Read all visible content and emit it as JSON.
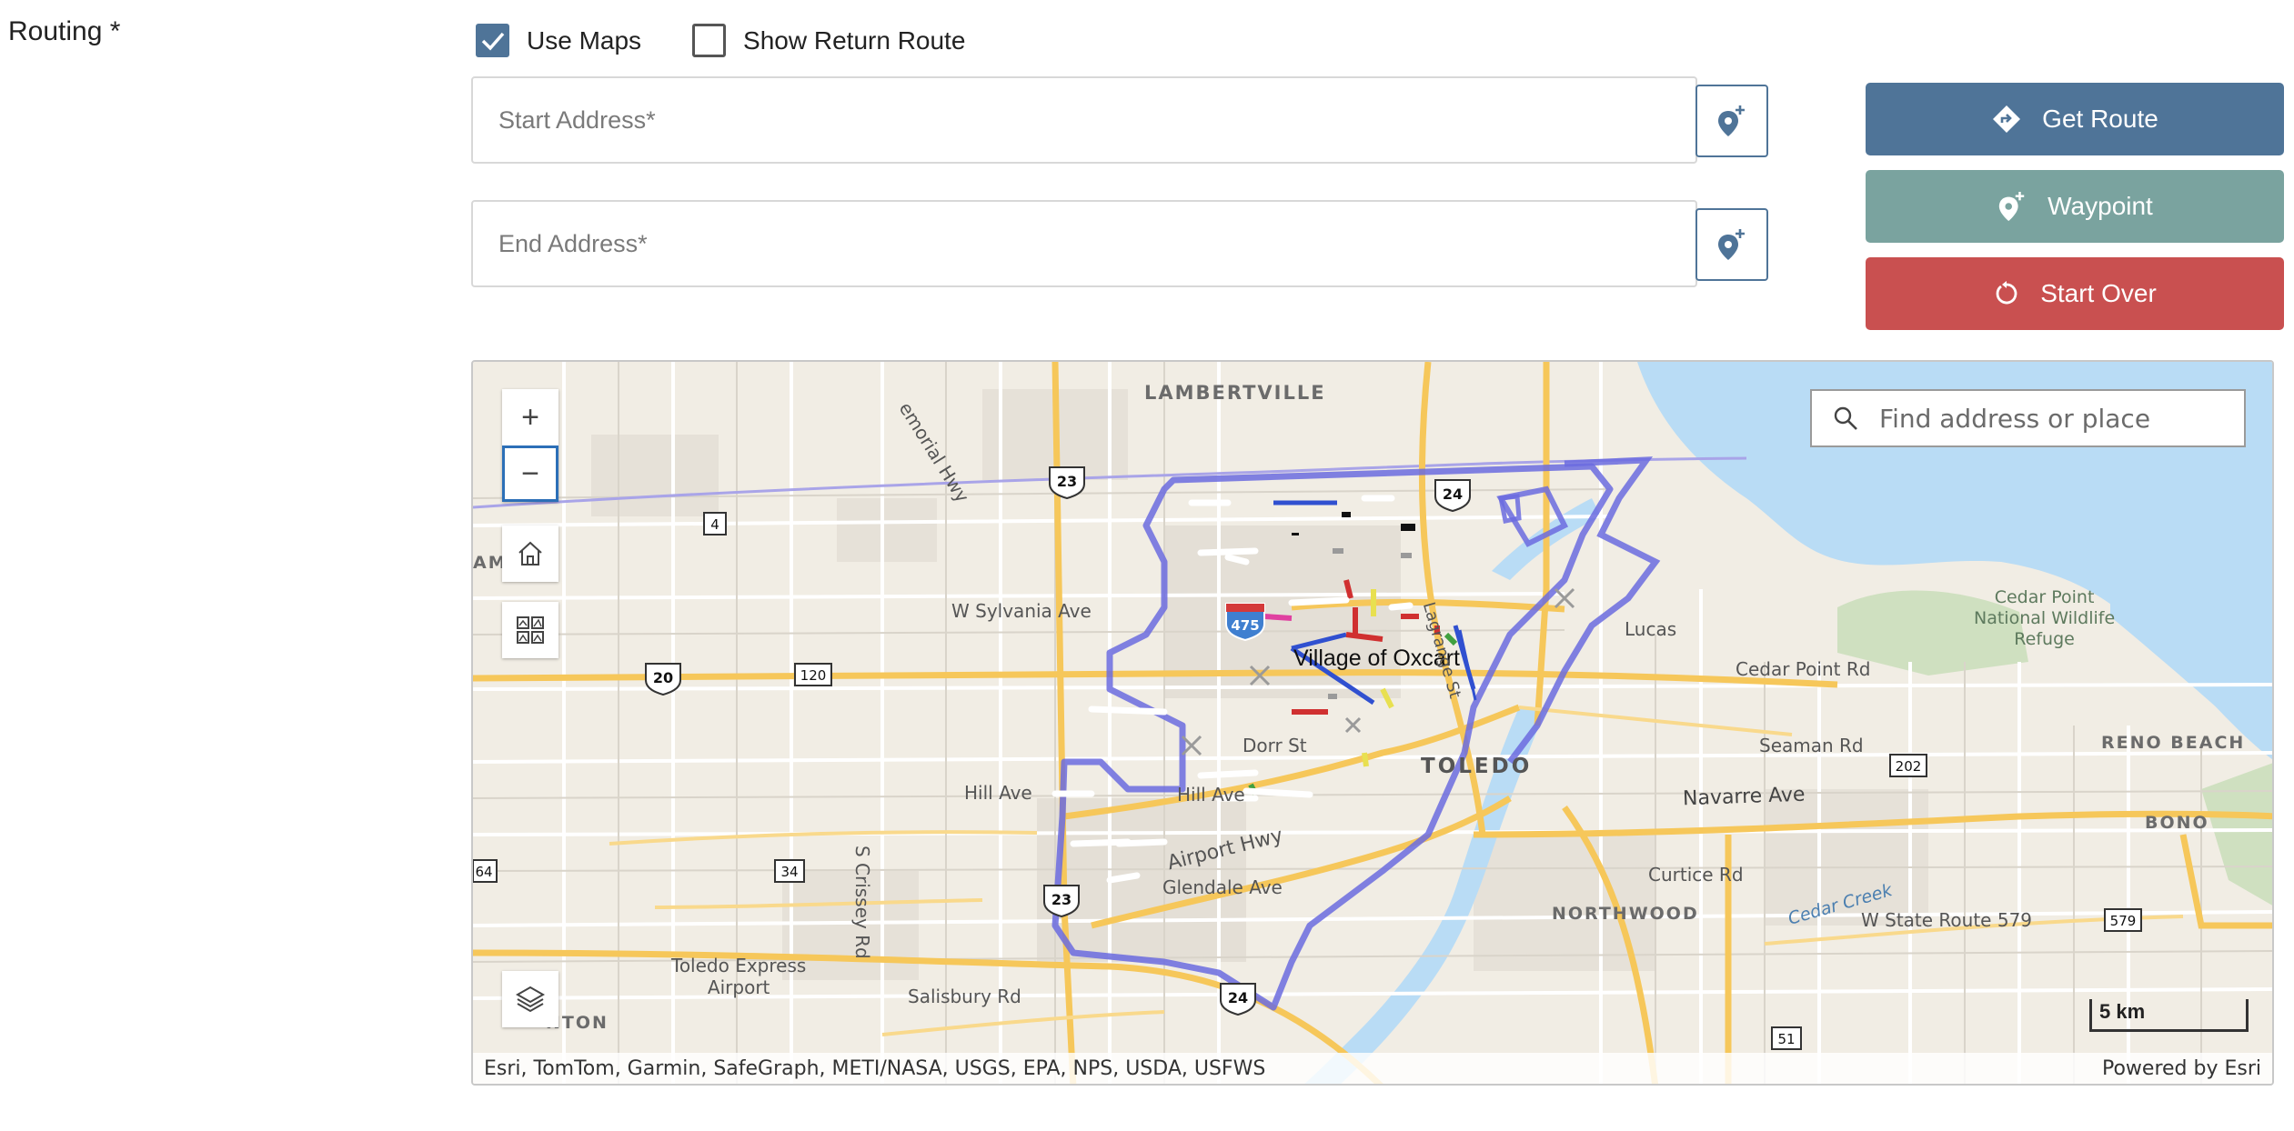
{
  "form": {
    "routing_label": "Routing *",
    "use_maps": {
      "label": "Use Maps",
      "checked": true
    },
    "show_return_route": {
      "label": "Show Return Route",
      "checked": false
    },
    "start_address": {
      "placeholder": "Start Address*",
      "value": ""
    },
    "end_address": {
      "placeholder": "End Address*",
      "value": ""
    }
  },
  "actions": {
    "get_route": "Get Route",
    "waypoint": "Waypoint",
    "start_over": "Start Over"
  },
  "colors": {
    "primary": "#4f7498",
    "waypoint": "#7aa39f",
    "danger": "#c95050",
    "route_outline": "#6b6bdf"
  },
  "map": {
    "search_placeholder": "Find address or place",
    "zoom_in": "+",
    "zoom_out": "−",
    "scale": "5 km",
    "attribution": "Esri, TomTom, Garmin, SafeGraph, METI/NASA, USGS, EPA, NPS, USDA, USFWS",
    "powered_by": "Powered by Esri",
    "labels": {
      "lambertville": "LAMBERTVILLE",
      "memorial_hwy": "emorial Hwy",
      "w_sylvania": "W Sylvania Ave",
      "village": "Village of Oxcart",
      "lucas": "Lucas",
      "cedar_point_park": "Cedar Point\nNational Wildlife\nRefuge",
      "cedar_point_rd": "Cedar Point Rd",
      "seaman_rd": "Seaman Rd",
      "reno_beach": "RENO BEACH",
      "bono": "BONO",
      "navarre_ave": "Navarre Ave",
      "toledo": "TOLEDO",
      "dorr_st": "Dorr St",
      "hill_ave_left": "Hill Ave",
      "hill_ave_mid": "Hill Ave",
      "airport_hwy": "Airport Hwy",
      "glendale": "Glendale Ave",
      "curtice_rd": "Curtice Rd",
      "cedar_creek": "Cedar Creek",
      "w_state_route": "W State Route 579",
      "northwood": "NORTHWOOD",
      "s_crissey": "S Crissey Rd",
      "toledo_express": "Toledo Express\nAirport",
      "salisbury": "Salisbury Rd",
      "nton": "NTON",
      "amo": "AMO",
      "lagrange": "Lagrange St"
    },
    "shields": {
      "us23_top": "23",
      "us24_top": "24",
      "r4": "4",
      "i475": "475",
      "us20": "20",
      "r120": "120",
      "r34": "34",
      "r64": "64",
      "us23_bottom": "23",
      "us24_bottom": "24",
      "r202": "202",
      "r579": "579",
      "r51": "51"
    }
  }
}
